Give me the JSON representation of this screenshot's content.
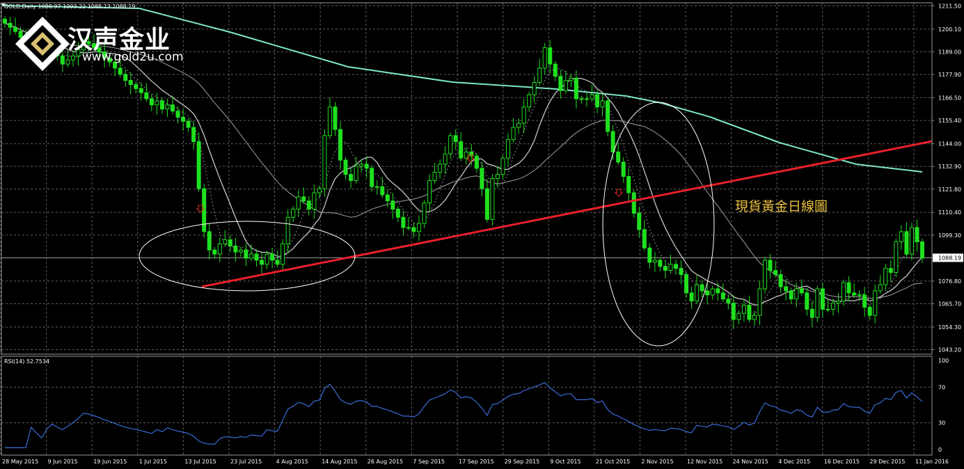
{
  "chart_header": "GOLD,Daily  1088.97 1093.22 1088.13 1088.19",
  "rsi_header": "RSI(14) 52.7534",
  "logo": {
    "name": "汉声金业",
    "url": "www.gold2u.com"
  },
  "annotation": "現貨黃金日線圖",
  "colors": {
    "background": "#000000",
    "grid": "#606060",
    "candle": "#1fe01f",
    "trendline": "#e8202a",
    "ma_long": "#7ee8c8",
    "ma_short": "#b0b0b0",
    "rsi": "#3a6cd8",
    "annotation": "#e8c040"
  },
  "chart_data": [
    {
      "type": "candlestick",
      "title": "GOLD,Daily",
      "x_ticks": [
        "28 May 2015",
        "9 Jun 2015",
        "19 Jun 2015",
        "1 Jul 2015",
        "13 Jul 2015",
        "23 Jul 2015",
        "4 Aug 2015",
        "14 Aug 2015",
        "26 Aug 2015",
        "7 Sep 2015",
        "17 Sep 2015",
        "29 Sep 2015",
        "9 Oct 2015",
        "21 Oct 2015",
        "2 Nov 2015",
        "12 Nov 2015",
        "24 Nov 2015",
        "4 Dec 2015",
        "16 Dec 2015",
        "29 Dec 2015",
        "11 Jan 2016"
      ],
      "y_ticks": [
        "1211.50",
        "1200.10",
        "1189.00",
        "1177.90",
        "1166.50",
        "1155.40",
        "1144.00",
        "1132.90",
        "1121.80",
        "1110.40",
        "1099.30",
        "1088.19",
        "1076.80",
        "1065.70",
        "1054.30",
        "1043.20"
      ],
      "ylim": [
        1041,
        1213
      ],
      "current_price": 1088.19,
      "grid": true,
      "close": [
        1203,
        1201,
        1199,
        1196,
        1194,
        1197,
        1193,
        1186,
        1189,
        1191,
        1187,
        1183,
        1185,
        1187,
        1190,
        1194,
        1193,
        1191,
        1189,
        1186,
        1184,
        1181,
        1178,
        1175,
        1173,
        1171,
        1169,
        1166,
        1163,
        1165,
        1161,
        1163,
        1160,
        1157,
        1155,
        1152,
        1145,
        1122,
        1101,
        1092,
        1090,
        1095,
        1097,
        1094,
        1091,
        1092,
        1088,
        1090,
        1087,
        1085,
        1090,
        1087,
        1085,
        1095,
        1108,
        1112,
        1118,
        1116,
        1112,
        1120,
        1122,
        1148,
        1162,
        1151,
        1136,
        1129,
        1126,
        1133,
        1134,
        1132,
        1123,
        1123,
        1119,
        1116,
        1112,
        1108,
        1103,
        1103,
        1101,
        1105,
        1115,
        1126,
        1130,
        1134,
        1139,
        1148,
        1145,
        1137,
        1140,
        1138,
        1132,
        1122,
        1107,
        1127,
        1129,
        1137,
        1146,
        1152,
        1154,
        1162,
        1168,
        1174,
        1181,
        1191,
        1183,
        1177,
        1170,
        1175,
        1176,
        1166,
        1166,
        1166,
        1168,
        1162,
        1165,
        1150,
        1140,
        1135,
        1128,
        1120,
        1110,
        1102,
        1093,
        1086,
        1087,
        1084,
        1082,
        1085,
        1083,
        1080,
        1071,
        1067,
        1075,
        1072,
        1070,
        1073,
        1071,
        1068,
        1066,
        1058,
        1061,
        1065,
        1058,
        1060,
        1073,
        1087,
        1082,
        1080,
        1074,
        1072,
        1068,
        1073,
        1071,
        1063,
        1059,
        1073,
        1063,
        1063,
        1066,
        1067,
        1076,
        1071,
        1070,
        1070,
        1064,
        1060,
        1072,
        1075,
        1083,
        1081,
        1096,
        1101,
        1090,
        1103,
        1096,
        1088
      ]
    },
    {
      "type": "line",
      "title": "RSI(14) 52.7534",
      "y_ticks": [
        "100",
        "70",
        "30",
        "0"
      ],
      "ylim": [
        0,
        100
      ],
      "current_value": 52.7534
    }
  ]
}
